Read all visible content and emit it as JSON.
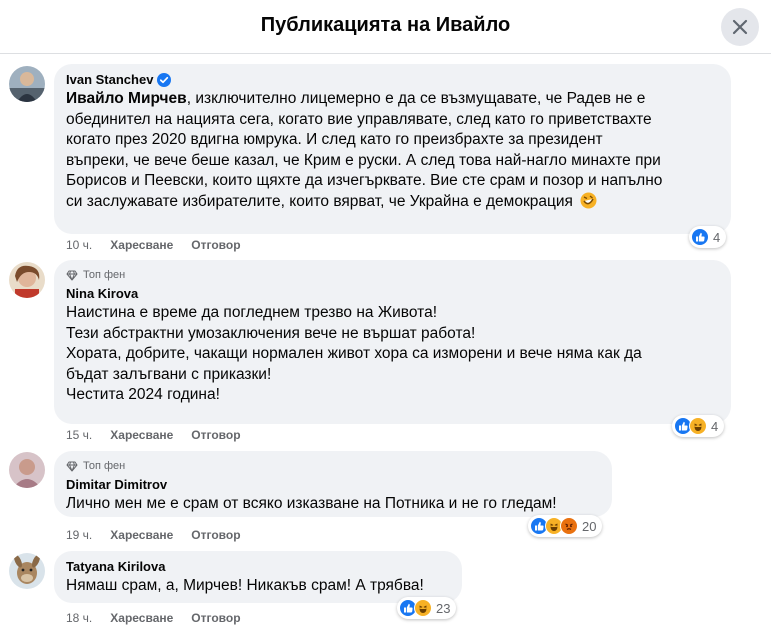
{
  "header": {
    "title": "Публикацията на Ивайло"
  },
  "comments": [
    {
      "author": "Ivan Stanchev",
      "mention": "Ивайло Мирчев",
      "lines": [
        ", изключително лицемерно е да се възмущавате, че Радев не е",
        "обединител на нацията сега, когато вие управлявате, след като го приветствахте",
        "когато през 2020 вдигна юмрука. И след като го преизбрахте за президент",
        "въпреки, че вече беше казал, че Крим е руски. А след това най-нагло минахте при",
        "Борисов и Пеевски, които щяхте да изчегърквате. Вие сте срам и позор и напълно",
        "си заслужавате избирателите, които вярват, че Украйна е демокрация"
      ],
      "time": "10 ч.",
      "like_label": "Харесване",
      "reply_label": "Отговор",
      "reaction_count": "4",
      "reactions": [
        "like-icon"
      ]
    },
    {
      "badge": "Топ фен",
      "author": "Nina Kirova",
      "lines": [
        "Наистина е време да погледнем трезво на Живота!",
        "Тези абстрактни умозаключения вече не вършат работа!",
        "Хората, добрите, чакащи нормален живот хора са изморени и вече няма как да",
        "бъдат залъгвани с приказки!",
        "Честита 2024 година!"
      ],
      "time": "15 ч.",
      "like_label": "Харесване",
      "reply_label": "Отговор",
      "reaction_count": "4",
      "reactions": [
        "like-icon",
        "haha-icon"
      ]
    },
    {
      "badge": "Топ фен",
      "author": "Dimitar Dimitrov",
      "lines": [
        "Лично мен ме е срам от всяко изказване на Потника и не го гледам!"
      ],
      "time": "19 ч.",
      "like_label": "Харесване",
      "reply_label": "Отговор",
      "reaction_count": "20",
      "reactions": [
        "like-icon",
        "haha-icon",
        "angry-icon"
      ]
    },
    {
      "author": "Tatyana Kirilova",
      "lines": [
        "Нямаш срам, а, Мирчев! Никакъв срам! А трябва!"
      ],
      "time": "18 ч.",
      "like_label": "Харесване",
      "reply_label": "Отговор",
      "reaction_count": "23",
      "reactions": [
        "like-icon",
        "haha-icon"
      ]
    }
  ],
  "colors": {
    "bubble": "#f0f2f5",
    "like": "#1877f2",
    "haha": "#f7b125",
    "angry": "#e9710f",
    "verified": "#1877f2",
    "muted": "#65676b"
  }
}
